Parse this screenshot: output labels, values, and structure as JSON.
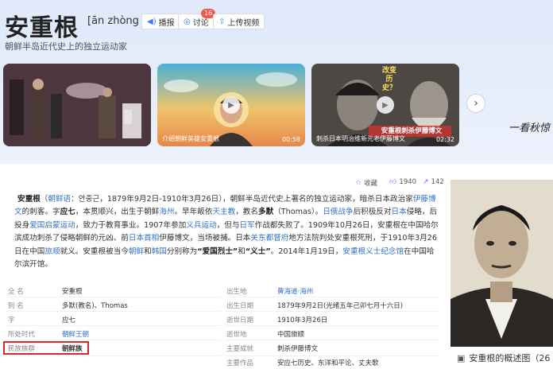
{
  "header": {
    "title": "安重根",
    "pinyin": "[ān zhòng gēn]",
    "subtitle": "朝鲜半岛近代史上的独立运动家",
    "buttons": {
      "play": "播报",
      "discuss": "讨论",
      "discuss_badge": "16",
      "upload": "上传视频"
    }
  },
  "videos": [
    {
      "caption": "",
      "duration": ""
    },
    {
      "caption": "介绍朝鲜英雄安重根",
      "duration": "00:58"
    },
    {
      "caption": "刺杀日本明治维新元老伊藤博文",
      "duration": "02:32",
      "overlay_title": "安重根刺杀伊藤博文",
      "overlay_tag": "改变历史？"
    }
  ],
  "calligraphy": "一看秋惊",
  "actions": {
    "collect": "收藏",
    "likes": "1940",
    "shares": "142"
  },
  "summary": {
    "name": "安重根",
    "lang_link": "朝鲜语",
    "p1": "：안중근，1879年9月2日-1910年3月26日），朝鲜半岛近代史上著名的独立运动家，暗杀日本政治家",
    "link_ito": "伊藤博文",
    "p2": "的刺客。字",
    "zi": "应七",
    "p3": "，本贯顺兴，出生于朝鲜",
    "link_haizhou": "海州",
    "p4": "。早年皈依",
    "link_catholic": "天主教",
    "p5": "，教名",
    "duomo": "多默",
    "p6": "（Thomas）。",
    "link_war": "日俄战争",
    "p7": "后积极反对",
    "link_japan": "日本",
    "p8": "侵略，后投身",
    "link_enlight": "爱国启蒙运动",
    "p9": "，致力于教育事业。1907年参加",
    "link_yibing": "义兵运动",
    "p10": "，但与",
    "link_japarmy": "日军",
    "p11": "作战都失败了。1909年10月26日，安重根在中国哈尔滨成功刺杀了侵略朝鲜的元凶、前",
    "link_pm": "日本首相",
    "p12": "伊藤博文，当场被捕。日本",
    "link_kwantung": "关东都督府",
    "p13": "地方法院判处安重根死刑，于1910年3月26日在中国",
    "link_lushun": "旅顺",
    "p14": "就义。安重根被当今",
    "link_dprk": "朝鲜",
    "p15": "和",
    "link_rok": "韩国",
    "p16": "分别称为",
    "patriot": "“爱国烈士”",
    "p17": "和",
    "yishi": "“义士”",
    "p18": "。2014年1月19日，",
    "link_memorial": "安重根义士纪念馆",
    "p19": "在中国哈尔滨开馆。"
  },
  "infobox": {
    "left": [
      {
        "key": "全    名",
        "value": "安重根"
      },
      {
        "key": "别    名",
        "value": "多默(教名)、Thomas"
      },
      {
        "key": "字",
        "value": "应七"
      },
      {
        "key": "所处时代",
        "value": "朝鲜王朝"
      },
      {
        "key": "民族族群",
        "value": "朝鲜族"
      }
    ],
    "right": [
      {
        "key": "出生地",
        "value": "黄海道·海州"
      },
      {
        "key": "出生日期",
        "value": "1879年9月2日(光绪五年己卯七月十六日)"
      },
      {
        "key": "逝世日期",
        "value": "1910年3月26日"
      },
      {
        "key": "逝世地",
        "value": "中国旅顺"
      },
      {
        "key": "主要成就",
        "value": "刺杀伊藤博文"
      },
      {
        "key": "主要作品",
        "value": "安应七历史、东洋和平论、丈夫歌"
      }
    ]
  },
  "photo": {
    "caption": "安重根的概述图（26"
  },
  "colors": {
    "accent_blue": "#3471c8",
    "highlight_red": "#d62a2a",
    "badge_red": "#f45a4c"
  }
}
